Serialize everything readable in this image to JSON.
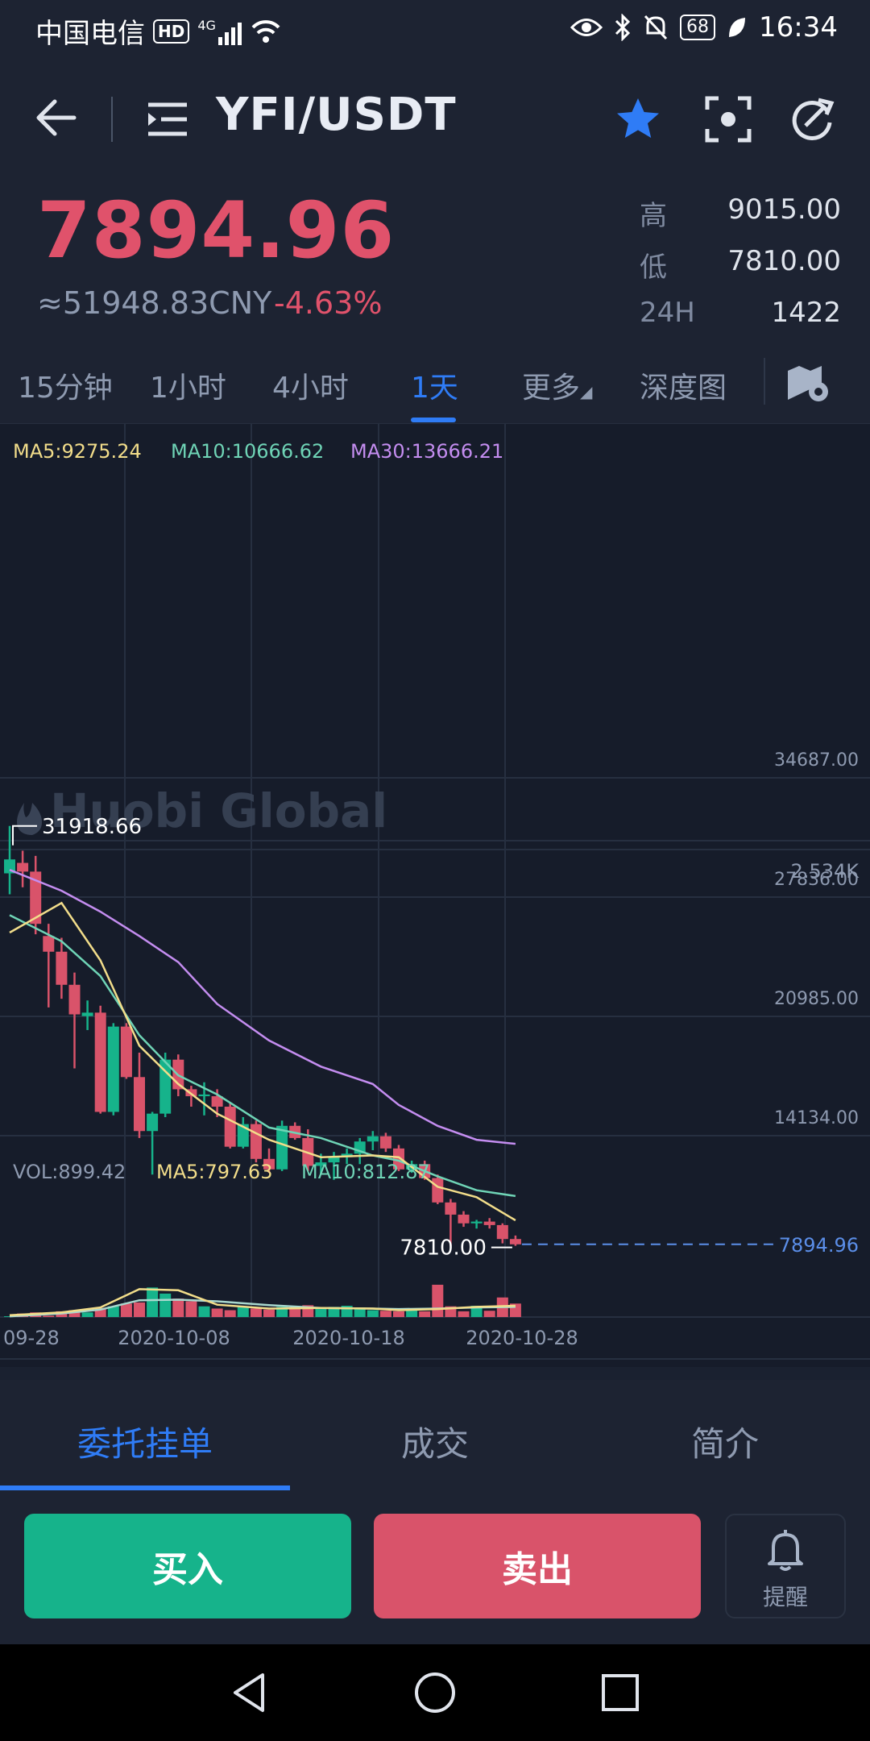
{
  "status_bar": {
    "carrier": "中国电信",
    "hd_badge": "HD",
    "network": "4G",
    "battery": "68",
    "time": "16:34"
  },
  "header": {
    "pair": "YFI/USDT",
    "favorite_color": "#2f7cf6"
  },
  "price": {
    "last": "7894.96",
    "cny": "≈51948.83CNY",
    "change": "-4.63%",
    "stats": [
      {
        "label": "高",
        "value": "9015.00"
      },
      {
        "label": "低",
        "value": "7810.00"
      },
      {
        "label": "24H",
        "value": "1422"
      }
    ]
  },
  "intervals": [
    "15分钟",
    "1小时",
    "4小时",
    "1天",
    "更多",
    "深度图"
  ],
  "active_interval": "1天",
  "chart_legend": {
    "ma5": "MA5:9275.24",
    "ma10": "MA10:10666.62",
    "ma30": "MA30:13666.21",
    "vol": "VOL:899.42",
    "vol_ma5": "MA5:797.63",
    "vol_ma10": "MA10:812.87",
    "watermark": "Huobi Global",
    "high_marker": "31918.66",
    "low_marker": "7810.00",
    "current_marker": "7894.96",
    "vol_axis": "2.534K"
  },
  "chart_data": {
    "type": "candlestick",
    "y_ticks": [
      "34687.00",
      "27836.00",
      "20985.00",
      "14134.00"
    ],
    "y_tick_values": [
      34687,
      27836,
      20985,
      14134
    ],
    "x_labels": [
      "09-28",
      "2020-10-08",
      "2020-10-18",
      "2020-10-28"
    ],
    "candles": [
      {
        "o": 29200,
        "h": 31918.66,
        "l": 28000,
        "c": 30000
      },
      {
        "o": 29800,
        "h": 30500,
        "l": 28400,
        "c": 29300
      },
      {
        "o": 29300,
        "h": 30200,
        "l": 25700,
        "c": 26300
      },
      {
        "o": 25600,
        "h": 26300,
        "l": 21500,
        "c": 24700
      },
      {
        "o": 24700,
        "h": 25500,
        "l": 22000,
        "c": 22800
      },
      {
        "o": 22800,
        "h": 23500,
        "l": 18000,
        "c": 21100
      },
      {
        "o": 21000,
        "h": 21900,
        "l": 20200,
        "c": 21200
      },
      {
        "o": 21200,
        "h": 21600,
        "l": 15400,
        "c": 15500
      },
      {
        "o": 15500,
        "h": 20600,
        "l": 15300,
        "c": 20400
      },
      {
        "o": 20400,
        "h": 20600,
        "l": 17400,
        "c": 17500
      },
      {
        "o": 17500,
        "h": 18900,
        "l": 14000,
        "c": 14400
      },
      {
        "o": 14400,
        "h": 15500,
        "l": 11900,
        "c": 15400
      },
      {
        "o": 15400,
        "h": 18900,
        "l": 15200,
        "c": 18500
      },
      {
        "o": 18500,
        "h": 18800,
        "l": 16400,
        "c": 16800
      },
      {
        "o": 16800,
        "h": 17000,
        "l": 15800,
        "c": 16400
      },
      {
        "o": 16400,
        "h": 17200,
        "l": 15300,
        "c": 16500
      },
      {
        "o": 16400,
        "h": 16800,
        "l": 15200,
        "c": 15800
      },
      {
        "o": 15800,
        "h": 16000,
        "l": 13400,
        "c": 13500
      },
      {
        "o": 13500,
        "h": 15200,
        "l": 13400,
        "c": 14800
      },
      {
        "o": 14800,
        "h": 15000,
        "l": 12600,
        "c": 12800
      },
      {
        "o": 12800,
        "h": 13400,
        "l": 12000,
        "c": 12200
      },
      {
        "o": 12200,
        "h": 15000,
        "l": 12100,
        "c": 14700
      },
      {
        "o": 14700,
        "h": 14900,
        "l": 13900,
        "c": 14000
      },
      {
        "o": 14000,
        "h": 14500,
        "l": 12100,
        "c": 12400
      },
      {
        "o": 12400,
        "h": 13100,
        "l": 11900,
        "c": 12600
      },
      {
        "o": 12600,
        "h": 13200,
        "l": 11600,
        "c": 12900
      },
      {
        "o": 12900,
        "h": 13400,
        "l": 12500,
        "c": 13100
      },
      {
        "o": 13100,
        "h": 14000,
        "l": 12500,
        "c": 13800
      },
      {
        "o": 13800,
        "h": 14400,
        "l": 13300,
        "c": 14100
      },
      {
        "o": 14100,
        "h": 14300,
        "l": 13200,
        "c": 13400
      },
      {
        "o": 13400,
        "h": 13600,
        "l": 12100,
        "c": 12200
      },
      {
        "o": 12200,
        "h": 12700,
        "l": 12000,
        "c": 12500
      },
      {
        "o": 12500,
        "h": 12700,
        "l": 11600,
        "c": 11700
      },
      {
        "o": 11700,
        "h": 11900,
        "l": 10200,
        "c": 10300
      },
      {
        "o": 10300,
        "h": 10500,
        "l": 7810,
        "c": 9600
      },
      {
        "o": 9600,
        "h": 9800,
        "l": 8900,
        "c": 9100
      },
      {
        "o": 9100,
        "h": 9300,
        "l": 8800,
        "c": 9200
      },
      {
        "o": 9200,
        "h": 9400,
        "l": 8800,
        "c": 9000
      },
      {
        "o": 9000,
        "h": 9100,
        "l": 7950,
        "c": 8200
      },
      {
        "o": 8200,
        "h": 8400,
        "l": 7810,
        "c": 7894.96
      }
    ],
    "volume": [
      130,
      180,
      200,
      140,
      220,
      240,
      200,
      280,
      310,
      360,
      380,
      650,
      540,
      450,
      400,
      310,
      270,
      240,
      300,
      270,
      250,
      300,
      260,
      330,
      270,
      300,
      320,
      290,
      240,
      230,
      220,
      250,
      220,
      700,
      310,
      220,
      320,
      230,
      470,
      360
    ],
    "ma5_line": [
      [
        0,
        25800
      ],
      [
        4,
        27500
      ],
      [
        7,
        24200
      ],
      [
        10,
        19300
      ],
      [
        13,
        17100
      ],
      [
        16,
        15400
      ],
      [
        20,
        13900
      ],
      [
        24,
        12900
      ],
      [
        28,
        13000
      ],
      [
        30,
        12900
      ],
      [
        33,
        11200
      ],
      [
        36,
        10600
      ],
      [
        39,
        9275.24
      ]
    ],
    "ma10_line": [
      [
        0,
        26800
      ],
      [
        4,
        25300
      ],
      [
        7,
        23300
      ],
      [
        10,
        19900
      ],
      [
        13,
        17600
      ],
      [
        16,
        16500
      ],
      [
        20,
        14600
      ],
      [
        24,
        14000
      ],
      [
        28,
        13000
      ],
      [
        30,
        12700
      ],
      [
        33,
        11800
      ],
      [
        36,
        11000
      ],
      [
        39,
        10666.62
      ]
    ],
    "ma30_line": [
      [
        0,
        29400
      ],
      [
        4,
        28200
      ],
      [
        7,
        27000
      ],
      [
        10,
        25600
      ],
      [
        13,
        24100
      ],
      [
        16,
        21700
      ],
      [
        20,
        19600
      ],
      [
        24,
        18100
      ],
      [
        28,
        17100
      ],
      [
        30,
        15900
      ],
      [
        33,
        14700
      ],
      [
        36,
        13900
      ],
      [
        39,
        13666.21
      ]
    ],
    "vol_ma5_line": [
      [
        0,
        150
      ],
      [
        4,
        200
      ],
      [
        7,
        290
      ],
      [
        10,
        620
      ],
      [
        13,
        600
      ],
      [
        16,
        340
      ],
      [
        20,
        270
      ],
      [
        24,
        280
      ],
      [
        28,
        270
      ],
      [
        30,
        240
      ],
      [
        33,
        260
      ],
      [
        36,
        300
      ],
      [
        39,
        320
      ]
    ],
    "vol_ma10_line": [
      [
        0,
        130
      ],
      [
        4,
        180
      ],
      [
        7,
        250
      ],
      [
        10,
        420
      ],
      [
        13,
        430
      ],
      [
        16,
        400
      ],
      [
        20,
        330
      ],
      [
        24,
        280
      ],
      [
        28,
        270
      ],
      [
        30,
        260
      ],
      [
        33,
        270
      ],
      [
        36,
        290
      ],
      [
        39,
        300
      ]
    ]
  },
  "bottom_tabs": [
    "委托挂单",
    "成交",
    "简介"
  ],
  "actions": {
    "buy": "买入",
    "sell": "卖出",
    "alert": "提醒"
  },
  "colors": {
    "up": "#16b38b",
    "down": "#d9536a",
    "ma5": "#f2dd8a",
    "ma10": "#6fd4b6",
    "ma30": "#c48df0",
    "accent": "#2f7cf6"
  }
}
